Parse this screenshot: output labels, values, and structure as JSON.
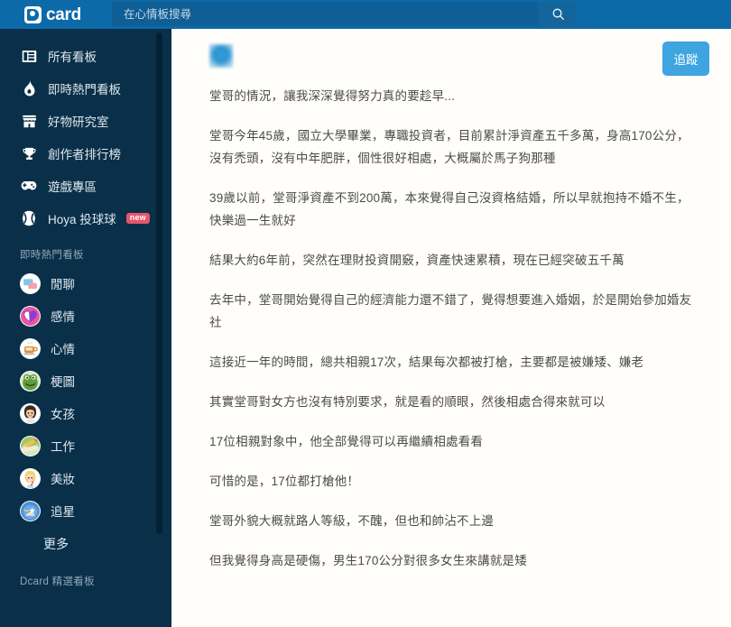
{
  "header": {
    "logo_text": "card",
    "logo_icon": "dcard-logo-icon",
    "search_placeholder": "在心情板搜尋",
    "search_value": "",
    "search_icon": "search-icon"
  },
  "sidebar": {
    "nav_items": [
      {
        "label": "所有看板",
        "icon": "boards-grid-icon",
        "badge": ""
      },
      {
        "label": "即時熱門看板",
        "icon": "flame-icon",
        "badge": ""
      },
      {
        "label": "好物研究室",
        "icon": "storefront-icon",
        "badge": ""
      },
      {
        "label": "創作者排行榜",
        "icon": "trophy-icon",
        "badge": ""
      },
      {
        "label": "遊戲專區",
        "icon": "gamepad-icon",
        "badge": ""
      },
      {
        "label": "Hoya 投球球",
        "icon": "baseball-icon",
        "badge": "new"
      }
    ],
    "section_label": "即時熱門看板",
    "boards": [
      {
        "label": "閒聊",
        "icon": "chat-bubbles-avatar"
      },
      {
        "label": "感情",
        "icon": "pink-heart-avatar"
      },
      {
        "label": "心情",
        "icon": "coffee-cup-avatar"
      },
      {
        "label": "梗圖",
        "icon": "frog-avatar"
      },
      {
        "label": "女孩",
        "icon": "girl-face-avatar"
      },
      {
        "label": "工作",
        "icon": "pencil-desk-avatar"
      },
      {
        "label": "美妝",
        "icon": "makeup-girl-avatar"
      },
      {
        "label": "追星",
        "icon": "star-fan-avatar"
      }
    ],
    "more_label": "更多",
    "featured_label": "Dcard 精選看板"
  },
  "post": {
    "author_blurred": true,
    "follow_label": "追蹤",
    "paragraphs": [
      "堂哥的情況，讓我深深覺得努力真的要趁早...",
      "堂哥今年45歲，國立大學畢業，專職投資者，目前累計淨資產五千多萬，身高170公分，沒有禿頭，沒有中年肥胖，個性很好相處，大概屬於馬子狗那種",
      "39歲以前，堂哥淨資產不到200萬，本來覺得自己沒資格結婚，所以早就抱持不婚不生，快樂過一生就好",
      "結果大約6年前，突然在理財投資開竅，資產快速累積，現在已經突破五千萬",
      "去年中，堂哥開始覺得自己的經濟能力還不錯了，覺得想要進入婚姻，於是開始參加婚友社",
      "這接近一年的時間，總共相親17次，結果每次都被打槍，主要都是被嫌矮、嫌老",
      "其實堂哥對女方也沒有特別要求，就是看的順眼，然後相處合得來就可以",
      "17位相親對象中，他全部覺得可以再繼續相處看看",
      "可惜的是，17位都打槍他！",
      "堂哥外貌大概就路人等級，不醜，但也和帥沾不上邊",
      "但我覺得身高是硬傷，男生170公分對很多女生來講就是矮"
    ]
  },
  "colors": {
    "header_blue": "#0d6aa8",
    "sidebar_navy": "#0a3049",
    "follow_blue": "#3ea5e0",
    "badge_red": "#e8546a",
    "content_bg": "#fffefb"
  }
}
